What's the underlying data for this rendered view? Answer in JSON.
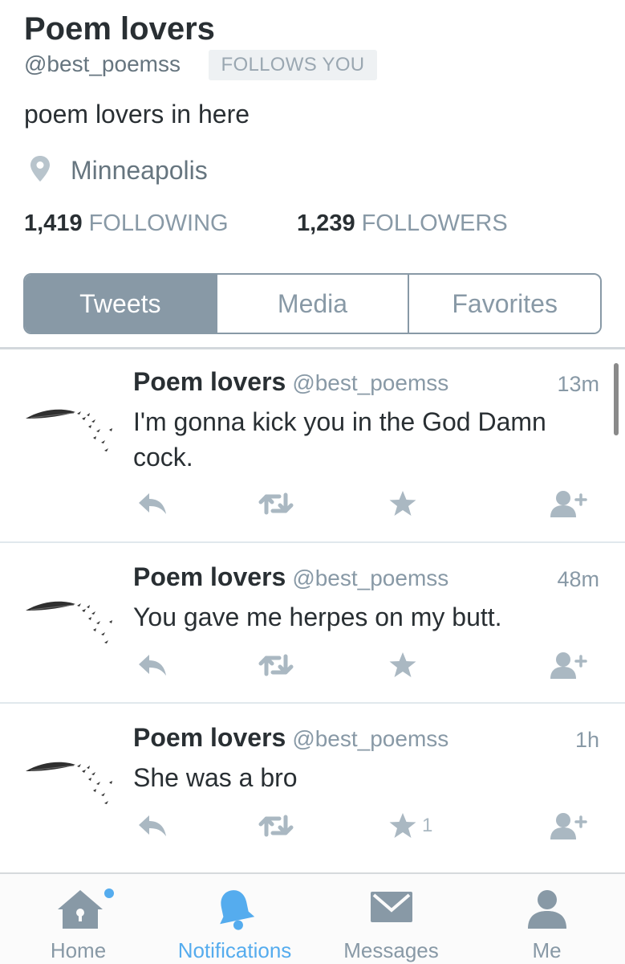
{
  "profile": {
    "name": "Poem lovers",
    "handle": "@best_poemss",
    "follows_badge": "FOLLOWS YOU",
    "bio": "poem lovers in here",
    "location": "Minneapolis",
    "following_count": "1,419",
    "following_label": "FOLLOWING",
    "followers_count": "1,239",
    "followers_label": "FOLLOWERS"
  },
  "tabs": [
    {
      "label": "Tweets",
      "active": true
    },
    {
      "label": "Media",
      "active": false
    },
    {
      "label": "Favorites",
      "active": false
    }
  ],
  "tweets": [
    {
      "name": "Poem lovers",
      "handle": "@best_poemss",
      "time": "13m",
      "text": "I'm gonna kick you in the God Damn cock.",
      "favorites": ""
    },
    {
      "name": "Poem lovers",
      "handle": "@best_poemss",
      "time": "48m",
      "text": "You gave me herpes on my butt.",
      "favorites": ""
    },
    {
      "name": "Poem lovers",
      "handle": "@best_poemss",
      "time": "1h",
      "text": "She was a bro",
      "favorites": "1"
    }
  ],
  "bottom_nav": [
    {
      "label": "Home",
      "icon": "home-icon",
      "active": false,
      "badge_dot": true
    },
    {
      "label": "Notifications",
      "icon": "bell-icon",
      "active": true,
      "badge_dot": false
    },
    {
      "label": "Messages",
      "icon": "envelope-icon",
      "active": false,
      "badge_dot": false
    },
    {
      "label": "Me",
      "icon": "person-icon",
      "active": false,
      "badge_dot": false
    }
  ],
  "colors": {
    "accent": "#55acee",
    "muted": "#8899a6",
    "text": "#292f33"
  }
}
